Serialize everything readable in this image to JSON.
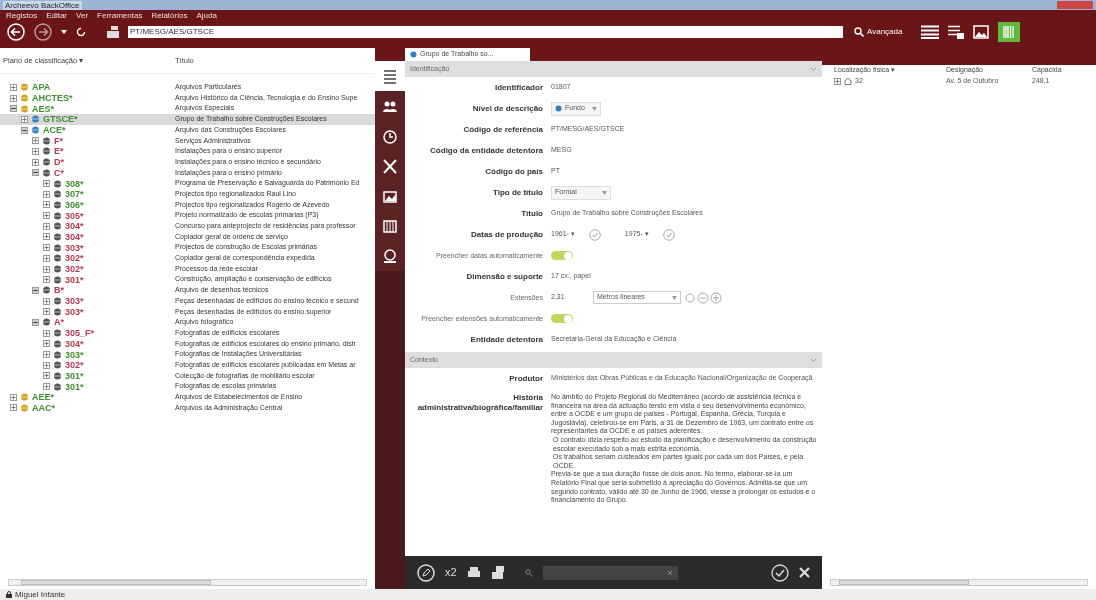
{
  "window": {
    "title": "Archeevo BackOffice"
  },
  "menu": [
    "Registos",
    "Editar",
    "Ver",
    "Ferramentas",
    "Relatórios",
    "Ajuda"
  ],
  "toolbar": {
    "address": "PT/MESG/AES/GTSCE",
    "advanced": "Avançada",
    "forward_disabled": true
  },
  "tree": {
    "columns": [
      "Plano de classificação ▾",
      "Título"
    ],
    "items": [
      {
        "code": "APA",
        "title": "Arquivos Particulares",
        "color": "#3f8f2f",
        "expanded": false,
        "selected": false
      },
      {
        "code": "AHCTES*",
        "title": "Arquivo Histórico da Ciência, Tecnologia e do Ensino Supe",
        "color": "#3f8f2f",
        "expanded": false,
        "selected": false
      },
      {
        "code": "AES*",
        "title": "Arquivos Especiais",
        "color": "#3f8f2f",
        "expanded": true,
        "selected": false,
        "children": [
          {
            "code": "GTSCE*",
            "title": "Grupo de Trabalho sobre Construções Escolares",
            "color": "#3f8f2f",
            "expanded": false,
            "selected": true
          },
          {
            "code": "ACE*",
            "title": "Arquivo das Construções Escolares",
            "color": "#3f8f2f",
            "expanded": true,
            "selected": false,
            "children": [
              {
                "code": "F*",
                "title": "Serviços Administrativos",
                "color": "#b23a52",
                "expanded": false,
                "selected": false
              },
              {
                "code": "E*",
                "title": "Instalações para o ensino superior",
                "color": "#b23a52",
                "expanded": false,
                "selected": false
              },
              {
                "code": "D*",
                "title": "Instalações para o ensino técnico e secundário",
                "color": "#b23a52",
                "expanded": false,
                "selected": false
              },
              {
                "code": "C*",
                "title": "Instalações para o ensino primário",
                "color": "#b23a52",
                "expanded": true,
                "selected": false,
                "children": [
                  {
                    "code": "308*",
                    "title": "Programa de Preservação e Salvaguarda do Património Ed",
                    "color": "#3f8f2f",
                    "expanded": false,
                    "selected": false
                  },
                  {
                    "code": "307*",
                    "title": "Projectos tipo regionalizados Raul Lino",
                    "color": "#3f8f2f",
                    "expanded": false,
                    "selected": false
                  },
                  {
                    "code": "306*",
                    "title": "Projectos tipo regionalizados Rogério de Azevedo",
                    "color": "#3f8f2f",
                    "expanded": false,
                    "selected": false
                  },
                  {
                    "code": "305*",
                    "title": "Projeto normalizado de escolas primárias (P3)",
                    "color": "#b23a52",
                    "expanded": false,
                    "selected": false
                  },
                  {
                    "code": "304*",
                    "title": "Concurso para anteprojecto de residências para professor",
                    "color": "#b23a52",
                    "expanded": false,
                    "selected": false
                  },
                  {
                    "code": "304*",
                    "title": "Copiador geral de ordens de serviço",
                    "color": "#b23a52",
                    "expanded": false,
                    "selected": false
                  },
                  {
                    "code": "303*",
                    "title": "Projectos de construção de Escolas primárias",
                    "color": "#b23a52",
                    "expanded": false,
                    "selected": false
                  },
                  {
                    "code": "302*",
                    "title": "Copiador geral de correspondência expedida",
                    "color": "#b23a52",
                    "expanded": false,
                    "selected": false
                  },
                  {
                    "code": "302*",
                    "title": "Processos da rede escolar",
                    "color": "#b23a52",
                    "expanded": false,
                    "selected": false
                  },
                  {
                    "code": "301*",
                    "title": "Construção, ampliação e conservação de edifícios",
                    "color": "#b23a52",
                    "expanded": false,
                    "selected": false
                  }
                ]
              },
              {
                "code": "B*",
                "title": "Arquivo de desenhos técnicos",
                "color": "#b23a52",
                "expanded": true,
                "selected": false,
                "children": [
                  {
                    "code": "303*",
                    "title": "Peças desenhadas de edifícios do ensino técnico e secund",
                    "color": "#b23a52",
                    "expanded": false,
                    "selected": false
                  },
                  {
                    "code": "303*",
                    "title": "Peças desenhadas de edifícios do ensino superior",
                    "color": "#b23a52",
                    "expanded": false,
                    "selected": false
                  }
                ]
              },
              {
                "code": "A*",
                "title": "Arquivo fotográfico",
                "color": "#b23a52",
                "expanded": true,
                "selected": false,
                "children": [
                  {
                    "code": "305_F*",
                    "title": "Fotografias de edifícios escolares",
                    "color": "#b23a52",
                    "expanded": false,
                    "selected": false
                  },
                  {
                    "code": "304*",
                    "title": "Fotografias de edifícios escolares do ensino primário, distr",
                    "color": "#b23a52",
                    "expanded": false,
                    "selected": false
                  },
                  {
                    "code": "303*",
                    "title": "Fotografias de Instalações Universitárias",
                    "color": "#3f8f2f",
                    "expanded": false,
                    "selected": false
                  },
                  {
                    "code": "302*",
                    "title": "Fotografias de edifícios escolares publicadas em Metas ar",
                    "color": "#b23a52",
                    "expanded": false,
                    "selected": false
                  },
                  {
                    "code": "301*",
                    "title": "Colecção de fotografias de mobiliário escolar",
                    "color": "#3f8f2f",
                    "expanded": false,
                    "selected": false
                  },
                  {
                    "code": "301*",
                    "title": "Fotografias de escolas primárias",
                    "color": "#3f8f2f",
                    "expanded": false,
                    "selected": false
                  }
                ]
              }
            ]
          }
        ]
      },
      {
        "code": "AEE*",
        "title": "Arquivos de Estabelecimentos de Ensino",
        "color": "#3f8f2f",
        "expanded": false,
        "selected": false
      },
      {
        "code": "AAC*",
        "title": "Arquivos da Administração Central",
        "color": "#3f8f2f",
        "expanded": false,
        "selected": false
      }
    ]
  },
  "record": {
    "tab": {
      "label": "Grupo de Trabalho so...",
      "selected": true
    },
    "side_tabs": [
      {
        "selected": true
      },
      {
        "selected": false
      },
      {
        "selected": false
      },
      {
        "selected": false
      },
      {
        "selected": false
      },
      {
        "selected": false
      },
      {
        "selected": false
      }
    ],
    "sections": [
      {
        "title": "Identificação",
        "expanded": true,
        "rows": [
          {
            "kind": "text",
            "label": "Identificador",
            "value": "01807"
          },
          {
            "kind": "select",
            "label": "Nível de descrição",
            "value": "Fundo",
            "icon": true
          },
          {
            "kind": "text",
            "label": "Código de referência",
            "value": "PT/MESG/AES/GTSCE"
          },
          {
            "kind": "text",
            "label": "Código da entidade detentora",
            "value": "MESG"
          },
          {
            "kind": "text",
            "label": "Código do país",
            "value": "PT"
          },
          {
            "kind": "select",
            "label": "Tipo de título",
            "value": "Formal",
            "icon": false
          },
          {
            "kind": "text",
            "label": "Título",
            "value": "Grupo de Trabalho sobre Construções Escolares"
          },
          {
            "kind": "dates",
            "label": "Datas de produção",
            "from": "1961- ▾",
            "to": "1975- ▾"
          },
          {
            "kind": "toggle",
            "label": "Preencher datas automaticamente",
            "on": true
          },
          {
            "kind": "text",
            "label": "Dimensão e suporte",
            "value": "17 cx., papel"
          },
          {
            "kind": "extent",
            "label": "Extensões",
            "value": "2,31",
            "unit": "Metros lineares"
          },
          {
            "kind": "toggle",
            "label": "Preencher extensões automaticamente",
            "on": true
          },
          {
            "kind": "text",
            "label": "Entidade detentora",
            "value": "Secretaria-Geral da Educação e Ciência"
          }
        ]
      },
      {
        "title": "Contexto",
        "expanded": true,
        "rows": [
          {
            "kind": "text",
            "label": "Produtor",
            "value": "Ministérios das Obras Públicas e da Educação Nacional/Organização de Cooperaçã"
          },
          {
            "kind": "paragraph",
            "label": "História administrativa/biográfica/familiar",
            "paragraphs": [
              "No âmbito do Projeto Regional do Mediterrâneo (acordo de assistência técnica e financeira na área da actuação tendo em vista o seu desenvolvimento económico, entre a OCDE e um grupo de países - Portugal, Espanha, Grécia, Turquia e Jugoslávia), celebrou-se em Paris, a 31 de Dezembro de 1963, um contrato entre os representantes da OCDE e os países aderentes.",
              "O contrato dizia respeito ao estudo da planificação e desenvolvimento da construção escolar executado sob a mais estrita economia.",
              "Os trabalhos seriam custeados em partes iguais por cada um dos Países, e pela OCDE.",
              "Previa-se que a sua duração fosse de dois anos. No termo, elaborar-se-ia um Relatório Final que seria submetido à apreciação do Governos. Admitia-se que um segundo contrato, válido até 30 de Junho de 1966, viesse a prolongar os estudos e o financiamento do Grupo."
            ]
          }
        ]
      }
    ],
    "bottom": {
      "copies": "x2"
    }
  },
  "locations": {
    "columns": [
      "Localização física ▾",
      "Designação",
      "Capacida"
    ],
    "rows": [
      {
        "code": "32",
        "designation": "Av. 5 de Outubro",
        "capacity": "248,1",
        "expanded": false
      }
    ]
  },
  "status_bar": {
    "user": "Miguel Infante"
  }
}
